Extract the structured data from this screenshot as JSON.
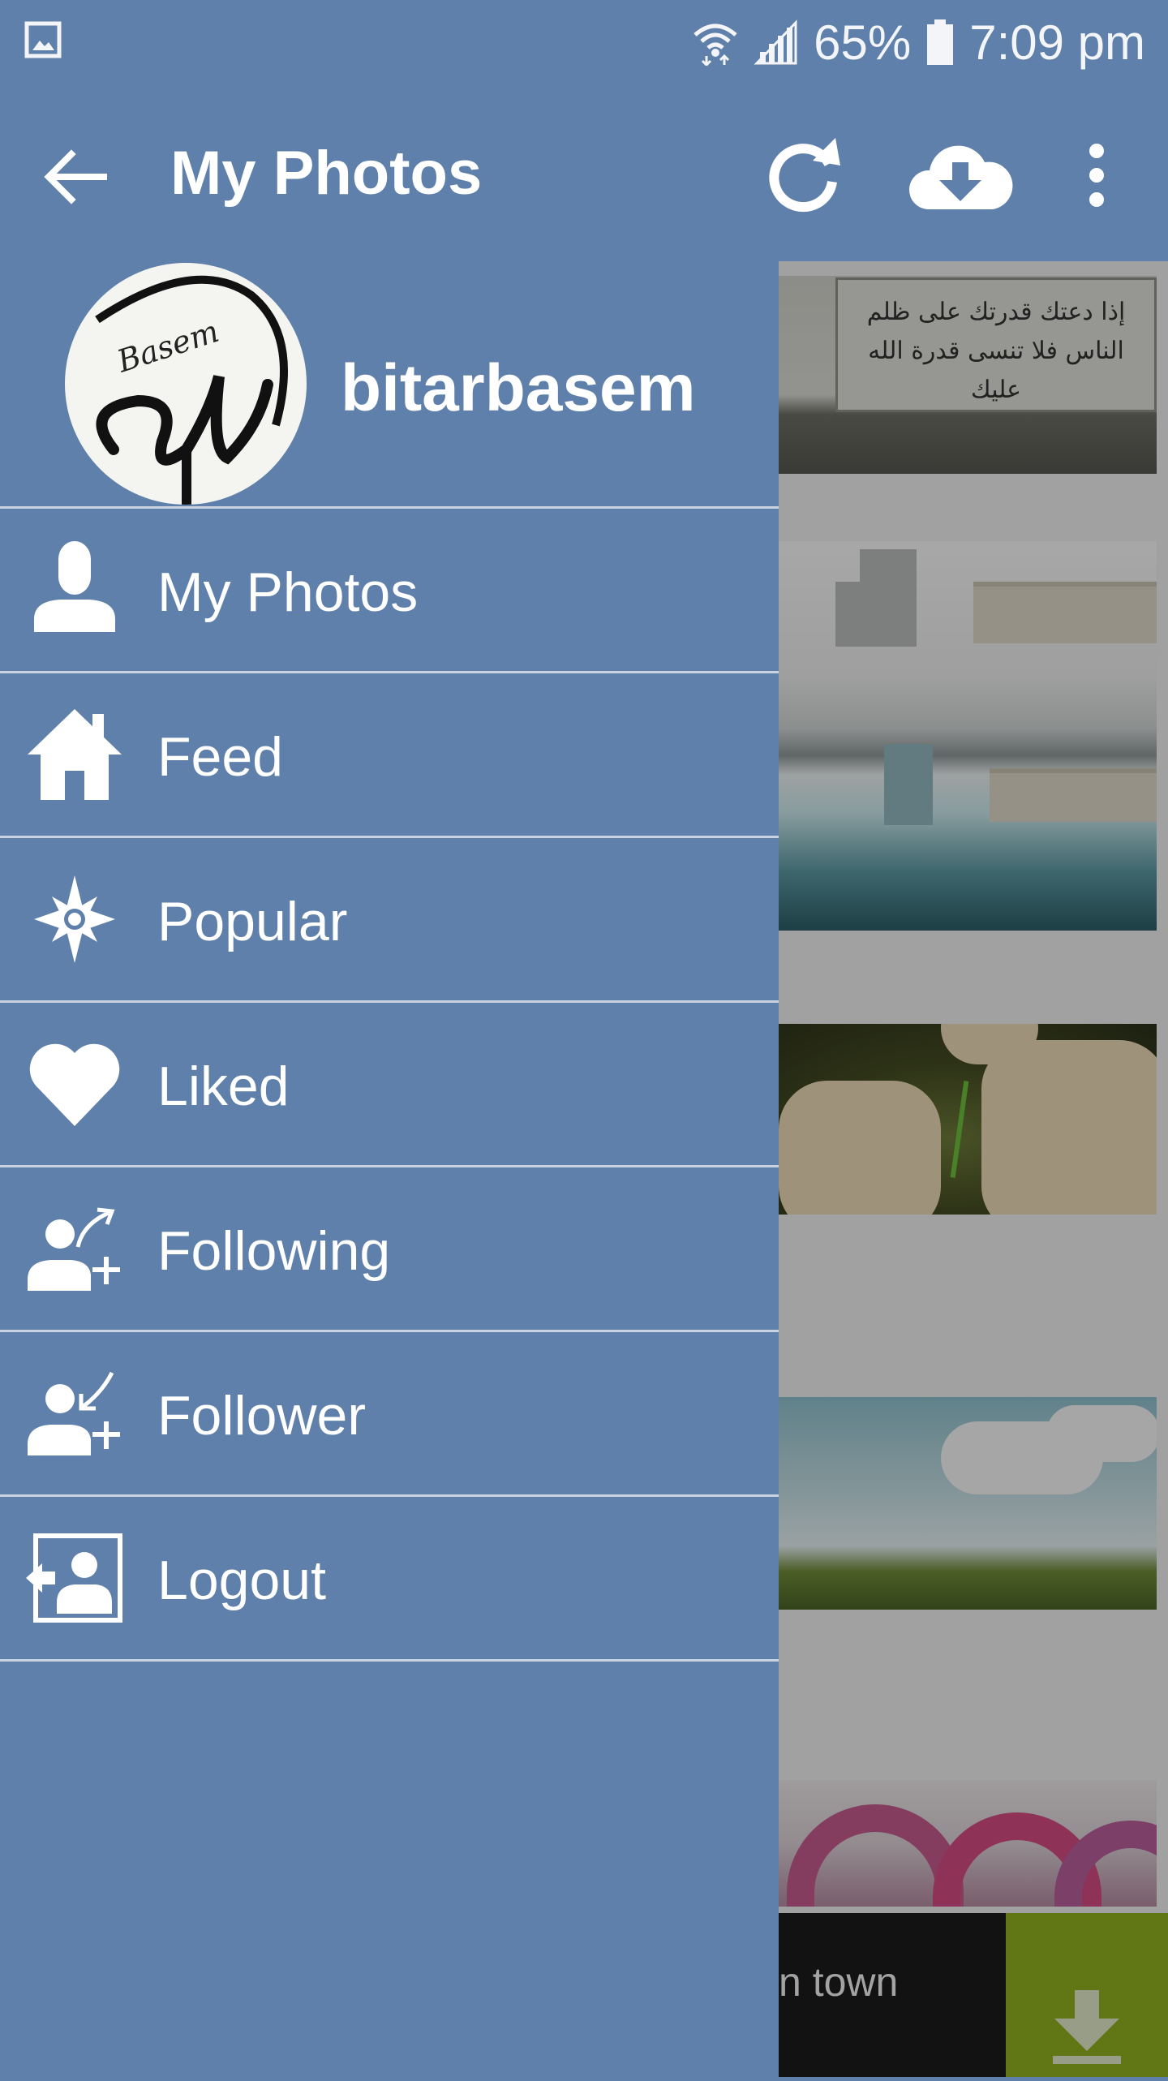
{
  "status_bar": {
    "battery_percent": "65%",
    "time": "7:09 pm",
    "icons": [
      "gallery-icon",
      "wifi-icon",
      "signal-icon",
      "battery-icon"
    ]
  },
  "app_bar": {
    "title": "My Photos",
    "actions": [
      "back-arrow-icon",
      "refresh-icon",
      "cloud-download-icon",
      "more-vert-icon"
    ]
  },
  "drawer": {
    "username": "bitarbasem",
    "avatar_signature": "Basem",
    "items": [
      {
        "label": "My Photos",
        "icon": "person-icon"
      },
      {
        "label": "Feed",
        "icon": "home-icon"
      },
      {
        "label": "Popular",
        "icon": "star-burst-icon"
      },
      {
        "label": "Liked",
        "icon": "heart-icon"
      },
      {
        "label": "Following",
        "icon": "person-add-arrow-up-icon"
      },
      {
        "label": "Follower",
        "icon": "person-add-arrow-down-icon"
      },
      {
        "label": "Logout",
        "icon": "logout-icon"
      }
    ]
  },
  "feed": {
    "photo_1_caption": "إذا دعتك قدرتك على ظلم الناس فلا تنسى قدرة الله عليك",
    "banner_text": "n town"
  },
  "colors": {
    "primary": "#5f80aa",
    "divider": "#c8d2e0",
    "ad_accent": "#8fae1f"
  }
}
